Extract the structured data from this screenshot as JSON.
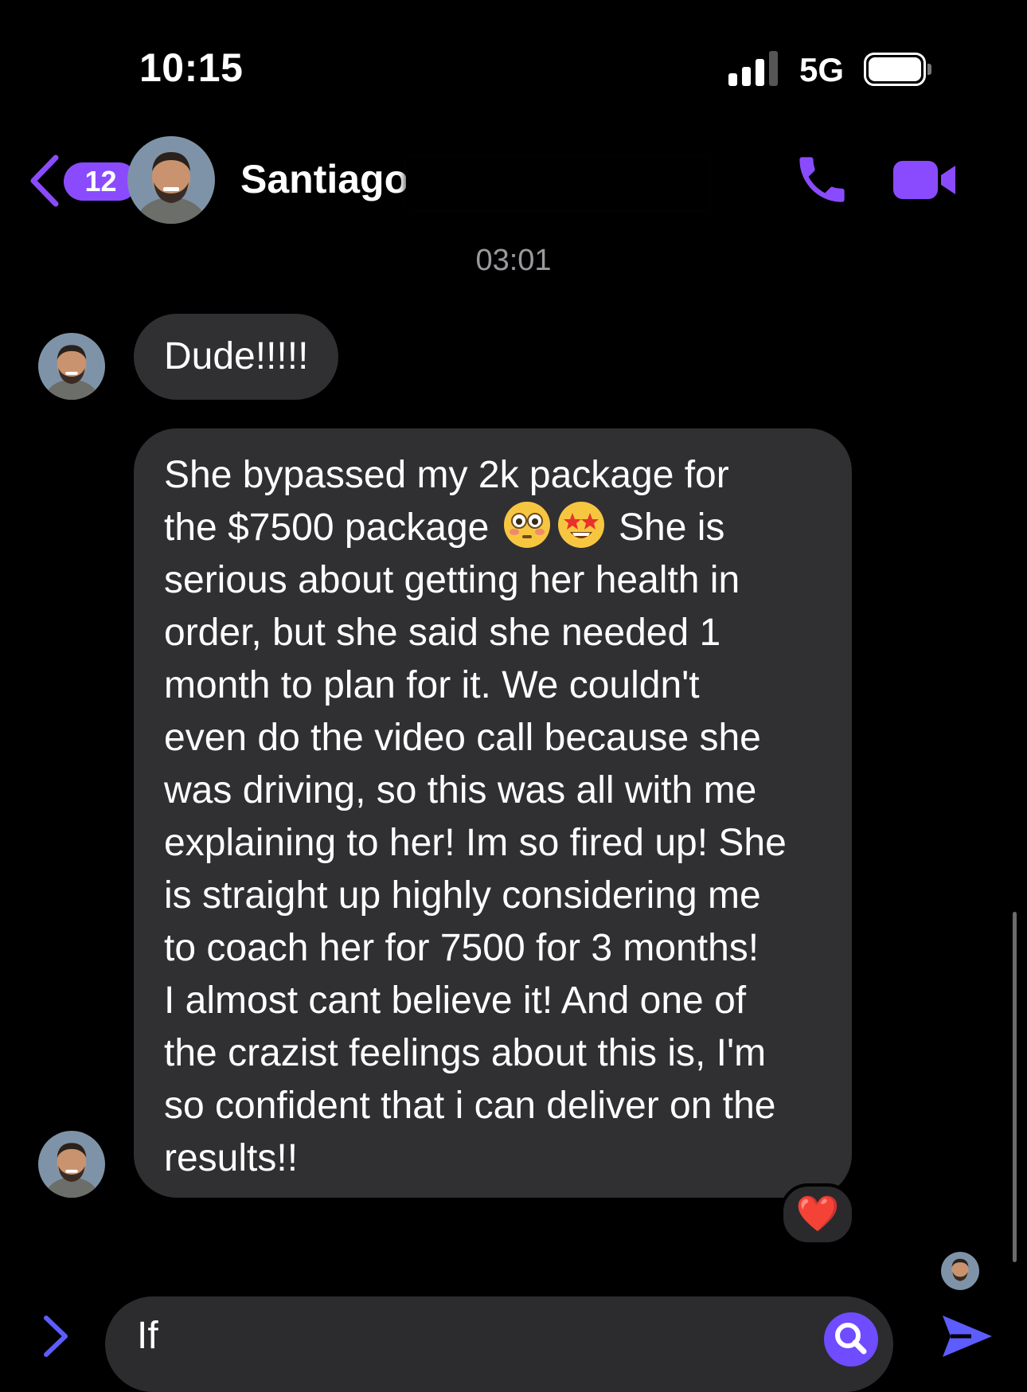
{
  "status_bar": {
    "time": "10:15",
    "network": "5G"
  },
  "header": {
    "unread_count": "12",
    "contact_name": "Santiago",
    "accent_color": "#8a4bff"
  },
  "thread": {
    "timestamp": "03:01",
    "messages": [
      {
        "text": "Dude!!!!!"
      },
      {
        "text_part1": "She bypassed my 2k package for\nthe $7500 package ",
        "text_part2": " She is\nserious about getting her health in\norder, but she said she needed 1\nmonth to plan for it. We couldn't\neven do the video call because she\nwas driving, so this was all with me\nexplaining to her! Im so fired up! She\nis straight up highly considering me\nto coach her for 7500 for 3 months!\nI almost cant believe it! And one of\nthe crazist feelings about this is, I'm\nso confident that i can deliver on the\nresults!!",
        "emojis": [
          "flushed-face",
          "star-struck-face"
        ],
        "reaction": "❤️"
      }
    ]
  },
  "composer": {
    "draft": "If"
  }
}
